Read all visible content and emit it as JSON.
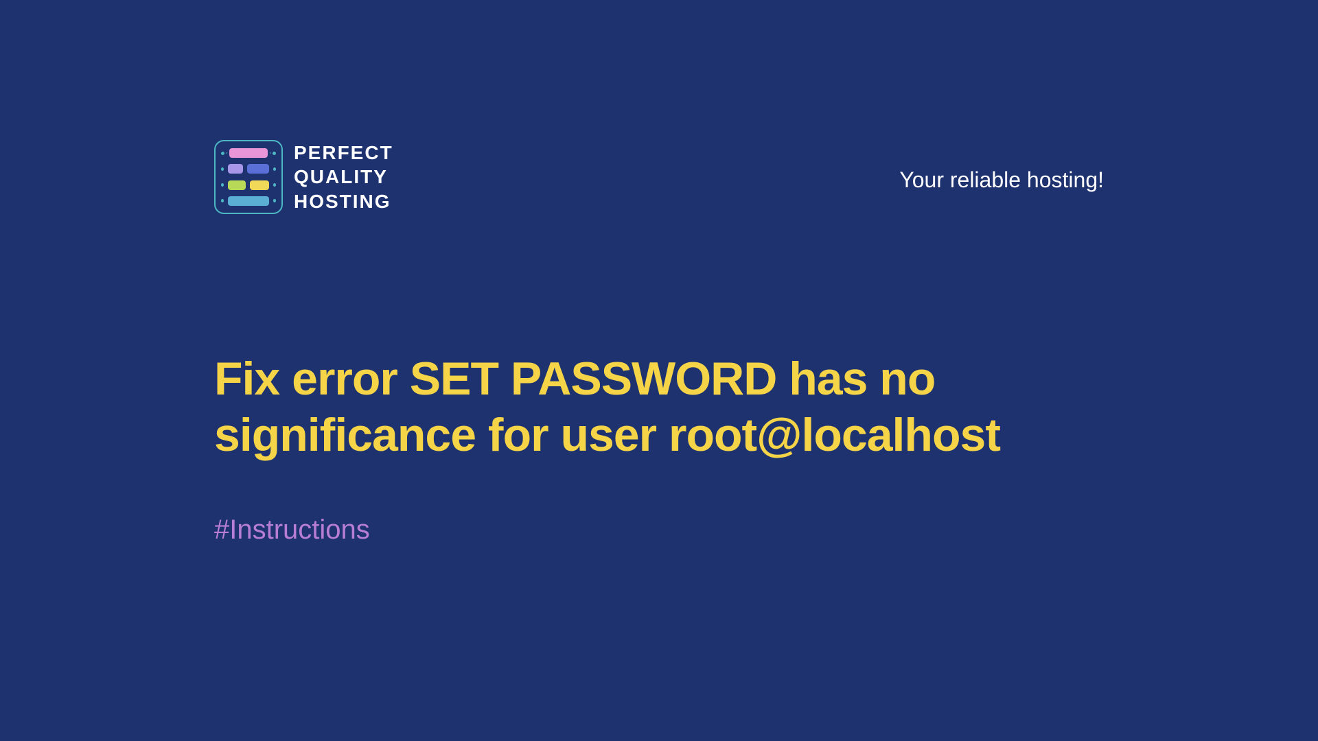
{
  "logo": {
    "line1": "PERFECT",
    "line2": "QUALITY",
    "line3": "HOSTING"
  },
  "tagline": "Your reliable hosting!",
  "headline": "Fix error SET PASSWORD has no significance for user root@localhost",
  "hashtag": "#Instructions"
}
